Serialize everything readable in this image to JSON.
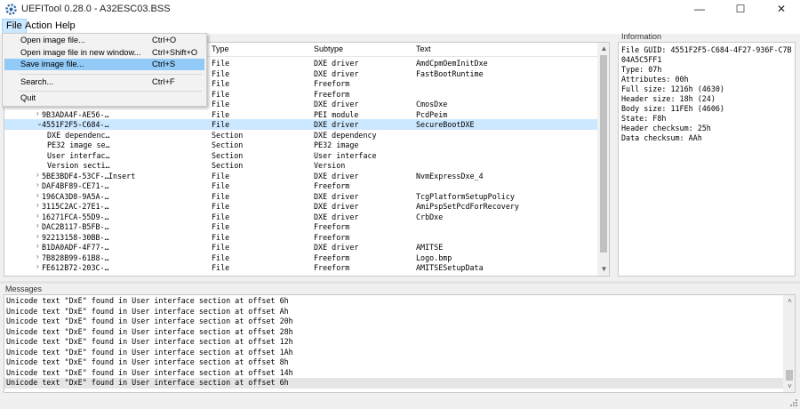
{
  "window": {
    "title": "UEFITool 0.28.0 - A32ESC03.BSS",
    "min_glyph": "—",
    "max_glyph": "☐",
    "close_glyph": "✕"
  },
  "menubar": {
    "file": "File",
    "action": "Action",
    "help": "Help"
  },
  "file_menu": {
    "items": [
      {
        "label": "Open image file...",
        "shortcut": "Ctrl+O"
      },
      {
        "label": "Open image file in new window...",
        "shortcut": "Ctrl+Shift+O"
      },
      {
        "label": "Save image file...",
        "shortcut": "Ctrl+S"
      },
      {
        "label": "Search...",
        "shortcut": "Ctrl+F"
      },
      {
        "label": "Quit",
        "shortcut": ""
      }
    ]
  },
  "tree": {
    "columns": [
      "Type",
      "Subtype",
      "Text"
    ],
    "rows": [
      {
        "name": "",
        "action": "",
        "type": "File",
        "subtype": "DXE driver",
        "text": "AmdCpmOemInitDxe",
        "chev": "",
        "sel": false
      },
      {
        "name": "",
        "action": "",
        "type": "File",
        "subtype": "DXE driver",
        "text": "FastBootRuntime",
        "chev": "",
        "sel": false
      },
      {
        "name": "",
        "action": "",
        "type": "File",
        "subtype": "Freeform",
        "text": "",
        "chev": "",
        "sel": false
      },
      {
        "name": "",
        "action": "",
        "type": "File",
        "subtype": "Freeform",
        "text": "",
        "chev": "",
        "sel": false
      },
      {
        "name": "",
        "action": "",
        "type": "File",
        "subtype": "DXE driver",
        "text": "CmosDxe",
        "chev": "",
        "sel": false
      },
      {
        "name": "9B3ADA4F-AE56-…",
        "action": "",
        "type": "File",
        "subtype": "PEI module",
        "text": "PcdPeim",
        "chev": "›",
        "sel": false
      },
      {
        "name": "4551F2F5-C684-…",
        "action": "",
        "type": "File",
        "subtype": "DXE driver",
        "text": "SecureBootDXE",
        "chev": "⌄",
        "sel": true
      },
      {
        "name": "DXE dependenc…",
        "action": "",
        "type": "Section",
        "subtype": "DXE dependency",
        "text": "",
        "chev": "",
        "sel": false,
        "child": true
      },
      {
        "name": "PE32 image se…",
        "action": "",
        "type": "Section",
        "subtype": "PE32 image",
        "text": "",
        "chev": "",
        "sel": false,
        "child": true
      },
      {
        "name": "User interfac…",
        "action": "",
        "type": "Section",
        "subtype": "User interface",
        "text": "",
        "chev": "",
        "sel": false,
        "child": true
      },
      {
        "name": "Version secti…",
        "action": "",
        "type": "Section",
        "subtype": "Version",
        "text": "",
        "chev": "",
        "sel": false,
        "child": true
      },
      {
        "name": "5BE3BDF4-53CF-…",
        "action": "Insert",
        "type": "File",
        "subtype": "DXE driver",
        "text": "NvmExpressDxe_4",
        "chev": "›",
        "sel": false
      },
      {
        "name": "DAF4BF89-CE71-…",
        "action": "",
        "type": "File",
        "subtype": "Freeform",
        "text": "",
        "chev": "›",
        "sel": false
      },
      {
        "name": "196CA3D8-9A5A-…",
        "action": "",
        "type": "File",
        "subtype": "DXE driver",
        "text": "TcgPlatformSetupPolicy",
        "chev": "›",
        "sel": false
      },
      {
        "name": "3115C2AC-27E1-…",
        "action": "",
        "type": "File",
        "subtype": "DXE driver",
        "text": "AmiPspSetPcdForRecovery",
        "chev": "›",
        "sel": false
      },
      {
        "name": "16271FCA-55D9-…",
        "action": "",
        "type": "File",
        "subtype": "DXE driver",
        "text": "CrbDxe",
        "chev": "›",
        "sel": false
      },
      {
        "name": "DAC2B117-B5FB-…",
        "action": "",
        "type": "File",
        "subtype": "Freeform",
        "text": "",
        "chev": "›",
        "sel": false
      },
      {
        "name": "92213158-30BB-…",
        "action": "",
        "type": "File",
        "subtype": "Freeform",
        "text": "",
        "chev": "›",
        "sel": false
      },
      {
        "name": "B1DA0ADF-4F77-…",
        "action": "",
        "type": "File",
        "subtype": "DXE driver",
        "text": "AMITSE",
        "chev": "›",
        "sel": false
      },
      {
        "name": "7B828B99-61B8-…",
        "action": "",
        "type": "File",
        "subtype": "Freeform",
        "text": "Logo.bmp",
        "chev": "›",
        "sel": false
      },
      {
        "name": "FE612B72-203C-…",
        "action": "",
        "type": "File",
        "subtype": "Freeform",
        "text": "AMITSESetupData",
        "chev": "›",
        "sel": false
      }
    ]
  },
  "info": {
    "label": "Information",
    "text": "File GUID: 4551F2F5-C684-4F27-936F-C7B04A5C5FF1\nType: 07h\nAttributes: 00h\nFull size: 1216h (4630)\nHeader size: 18h (24)\nBody size: 11FEh (4606)\nState: F8h\nHeader checksum: 25h\nData checksum: AAh"
  },
  "messages": {
    "label": "Messages",
    "items": [
      "Unicode text \"DxE\" found in User interface section at offset 6h",
      "Unicode text \"DxE\" found in User interface section at offset Ah",
      "Unicode text \"DxE\" found in User interface section at offset 20h",
      "Unicode text \"DxE\" found in User interface section at offset 28h",
      "Unicode text \"DxE\" found in User interface section at offset 12h",
      "Unicode text \"DxE\" found in User interface section at offset 1Ah",
      "Unicode text \"DxE\" found in User interface section at offset 8h",
      "Unicode text \"DxE\" found in User interface section at offset 14h",
      "Unicode text \"DxE\" found in User interface section at offset 6h"
    ],
    "selected_index": 8
  },
  "colors": {
    "selection": "#cce8ff",
    "menu_highlight": "#91c9f7"
  }
}
